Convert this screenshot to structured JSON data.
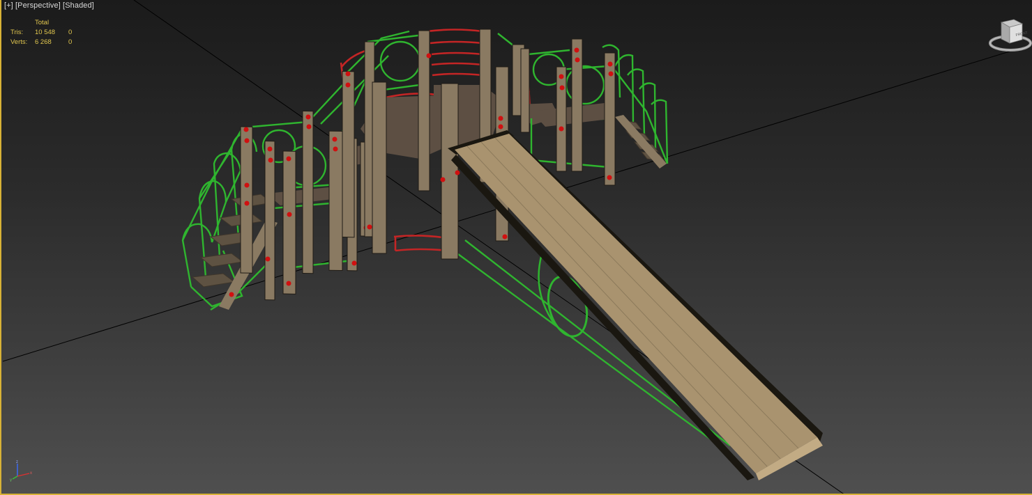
{
  "viewport": {
    "label": {
      "plus": "[+]",
      "view": "[Perspective]",
      "shading": "[Shaded]"
    },
    "stats": {
      "header": "Total",
      "rows": [
        {
          "label": "Tris:",
          "total": "10 548",
          "selected": "0"
        },
        {
          "label": "Verts:",
          "total": "6 268",
          "selected": "0"
        }
      ]
    },
    "viewcube": {
      "face_label": "FRONT",
      "icon": "viewcube-icon"
    },
    "axis_tripod": {
      "x": "x",
      "y": "y",
      "z": "z"
    },
    "scene": {
      "object": "playground-with-slide",
      "colors": {
        "wood": "#8a7a62",
        "wood_dark": "#5e5242",
        "platform": "#5d4f43",
        "slide_bed": "#a9936f",
        "slide_side": "#1a1710",
        "rail_green": "#2fb52f",
        "rail_red": "#c42525",
        "bolt_red": "#d01010",
        "grid_line": "#000000",
        "active_border": "#d8b236"
      }
    }
  }
}
